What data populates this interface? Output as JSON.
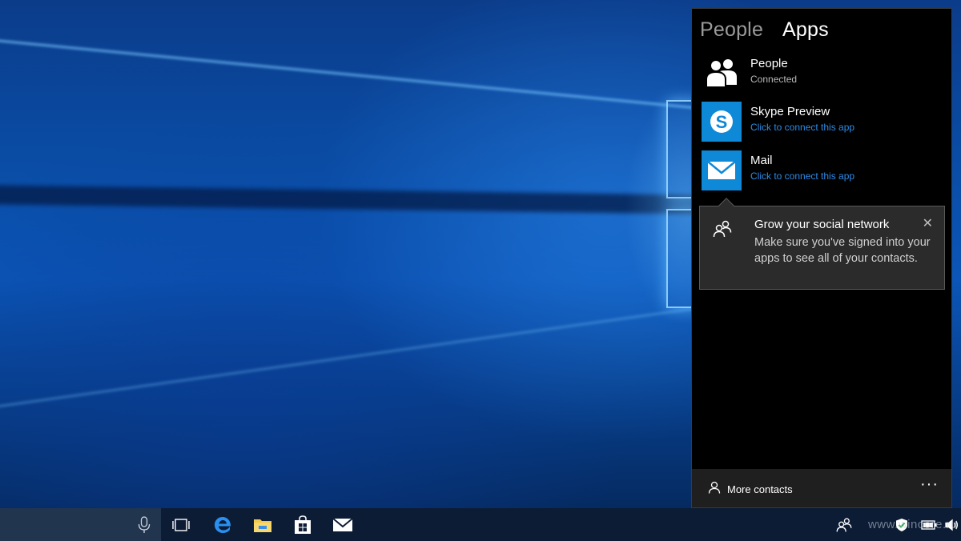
{
  "flyout": {
    "tabs": [
      {
        "label": "People",
        "active": false
      },
      {
        "label": "Apps",
        "active": true
      }
    ],
    "apps": [
      {
        "name": "People",
        "status": "Connected",
        "icon": "people-icon"
      },
      {
        "name": "Skype Preview",
        "status": "Click to connect this app",
        "icon": "skype-icon"
      },
      {
        "name": "Mail",
        "status": "Click to connect this app",
        "icon": "mail-icon"
      }
    ],
    "tip": {
      "title": "Grow your social network",
      "body": "Make sure you've signed into your apps to see all of your contacts.",
      "close": "✕"
    },
    "footer": {
      "more_contacts": "More contacts",
      "more_options": "···"
    }
  },
  "taskbar": {
    "pinned": [
      "task-view-icon",
      "edge-icon",
      "file-explorer-icon",
      "store-icon",
      "mail-icon"
    ],
    "tray_icons": [
      "people-icon",
      "chevron-up-icon",
      "defender-icon",
      "battery-icon",
      "volume-icon"
    ],
    "watermark": "www.wincore.ru"
  },
  "colors": {
    "accent": "#0d89d8",
    "link": "#2e8ae6",
    "panel_bg": "#000000",
    "taskbar_bg": "#0c1c34"
  }
}
